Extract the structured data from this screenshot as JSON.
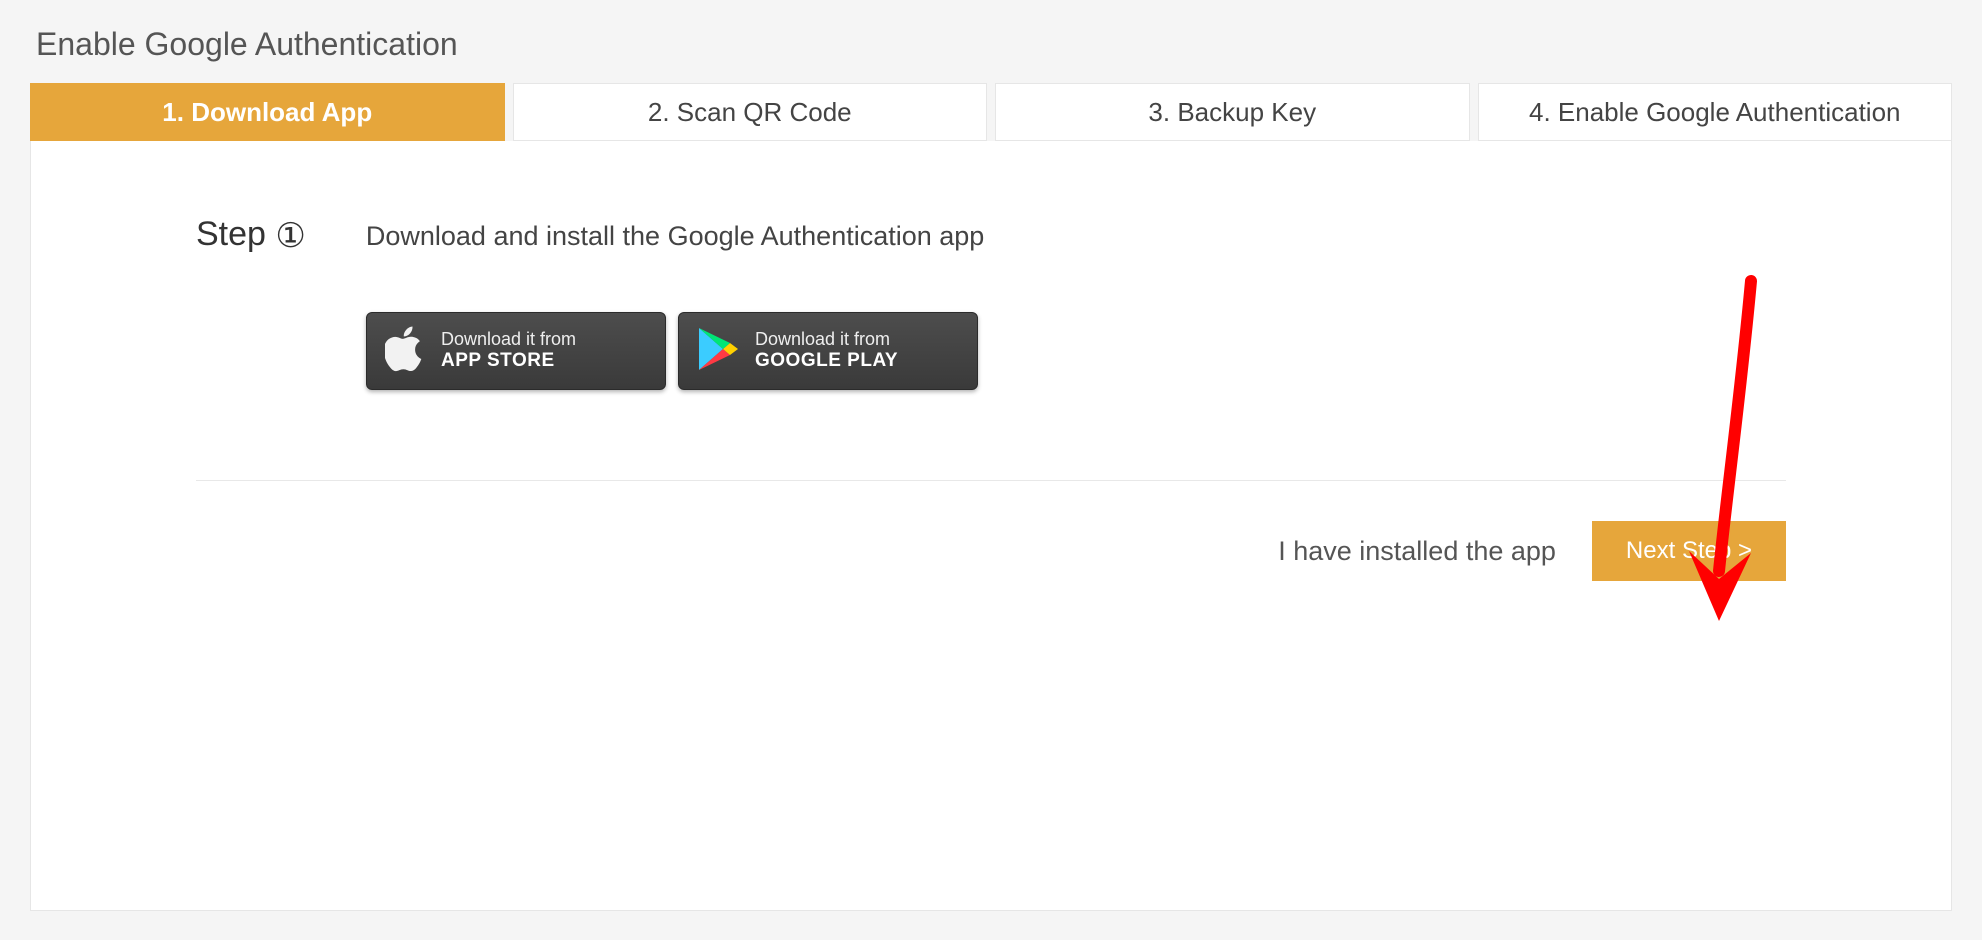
{
  "title": "Enable Google Authentication",
  "tabs": [
    {
      "label": "1. Download App",
      "active": true
    },
    {
      "label": "2. Scan QR Code",
      "active": false
    },
    {
      "label": "3. Backup Key",
      "active": false
    },
    {
      "label": "4. Enable Google Authentication",
      "active": false
    }
  ],
  "step": {
    "label_prefix": "Step ",
    "number_glyph": "①",
    "description": "Download and install the Google Authentication app"
  },
  "stores": {
    "apple": {
      "line1": "Download it from",
      "line2": "APP STORE"
    },
    "google": {
      "line1": "Download it from",
      "line2": "GOOGLE PLAY"
    }
  },
  "footer": {
    "installed_text": "I have installed the app",
    "next_label": "Next Step >"
  },
  "annotation": {
    "arrow_points_to": "next-step-button",
    "color": "#ff0000"
  }
}
